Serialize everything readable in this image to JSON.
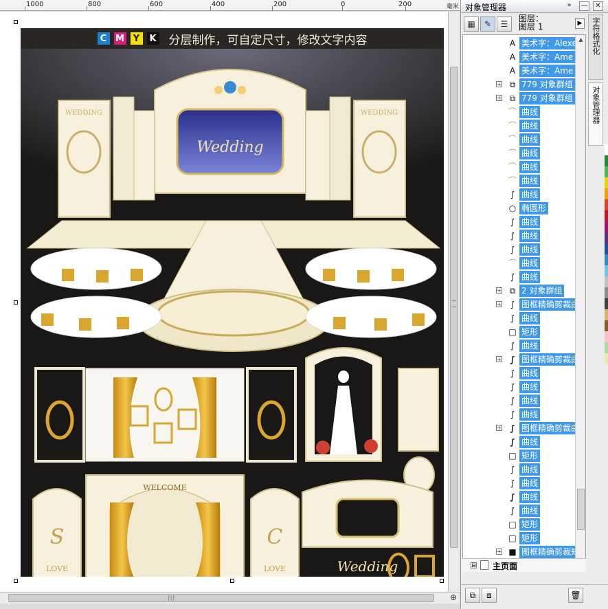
{
  "ruler": {
    "ticks": [
      "1000",
      "800",
      "600",
      "400",
      "200",
      "0",
      "200"
    ],
    "unit": "毫米"
  },
  "poster": {
    "banner": {
      "cmyk": [
        {
          "letter": "C",
          "color": "#1a7fd0"
        },
        {
          "letter": "M",
          "color": "#d21f7a"
        },
        {
          "letter": "Y",
          "color": "#f5e200"
        },
        {
          "letter": "K",
          "color": "#111111"
        }
      ],
      "text": "分层制作，可自定尺寸，修改文字内容"
    },
    "stage_texts": {
      "wedding_left": "WEDDING",
      "wedding_right": "WEDDING",
      "center_script": "Wedding",
      "welcome": "WELCOME",
      "love_left": "LOVE",
      "love_right": "LOVE",
      "monogram_left": "S",
      "monogram_right": "C",
      "bottom_script": "Wedding"
    }
  },
  "dock": {
    "title": "对象管理器",
    "title_buttons": {
      "collapse": "»",
      "minimize": "—",
      "close": "✕"
    },
    "layer_label": "图层：\n图层 1",
    "layer_arrow": "▶",
    "side_tabs": [
      "字符格式化",
      "对象管理器"
    ],
    "palette": [
      "#ffffff",
      "#1f8a3a",
      "#4db84d",
      "#e6d400",
      "#f0a000",
      "#e04020",
      "#c8102e",
      "#a01070",
      "#5a2d86",
      "#1f4fa0",
      "#2e8bc8",
      "#6ec3e8",
      "#bfbfbf",
      "#8c8c8c",
      "#404040",
      "#d9b26a",
      "#8a5a2b",
      "#f5c2c8",
      "#b0d9a0",
      "#e8e8b0"
    ],
    "objects": [
      {
        "icon": "text-icon",
        "label": "美术字：Alexe",
        "selected": true,
        "expandable": false
      },
      {
        "icon": "text-icon",
        "label": "美术字：Ame",
        "selected": true,
        "expandable": false
      },
      {
        "icon": "text-icon",
        "label": "美术字：Ame",
        "selected": true,
        "expandable": false
      },
      {
        "icon": "group-icon",
        "label": "779 对象群组",
        "selected": true,
        "expandable": true
      },
      {
        "icon": "group-icon",
        "label": "779 对象群组",
        "selected": true,
        "expandable": true
      },
      {
        "icon": "curve-light-icon",
        "label": "曲线",
        "selected": true,
        "expandable": false
      },
      {
        "icon": "curve-light-icon",
        "label": "曲线",
        "selected": true,
        "expandable": false
      },
      {
        "icon": "curve-light-icon",
        "label": "曲线",
        "selected": true,
        "expandable": false
      },
      {
        "icon": "curve-light-icon",
        "label": "曲线",
        "selected": true,
        "expandable": false
      },
      {
        "icon": "curve-light-icon",
        "label": "曲线",
        "selected": true,
        "expandable": false
      },
      {
        "icon": "curve-light-icon",
        "label": "曲线",
        "selected": true,
        "expandable": false
      },
      {
        "icon": "curve-icon",
        "label": "曲线",
        "selected": true,
        "expandable": false
      },
      {
        "icon": "ellipse-icon",
        "label": "椭圆形",
        "selected": true,
        "expandable": false
      },
      {
        "icon": "curve-icon",
        "label": "曲线",
        "selected": true,
        "expandable": false
      },
      {
        "icon": "curve-icon",
        "label": "曲线",
        "selected": true,
        "expandable": false
      },
      {
        "icon": "curve-icon",
        "label": "曲线",
        "selected": true,
        "expandable": false
      },
      {
        "icon": "curve-light-icon",
        "label": "曲线",
        "selected": true,
        "expandable": false
      },
      {
        "icon": "curve-icon",
        "label": "曲线",
        "selected": true,
        "expandable": false
      },
      {
        "icon": "group-icon",
        "label": "2 对象群组",
        "selected": true,
        "expandable": true
      },
      {
        "icon": "curve-icon",
        "label": "图框精确剪裁曲",
        "selected": true,
        "expandable": true
      },
      {
        "icon": "curve-icon",
        "label": "曲线",
        "selected": true,
        "expandable": false
      },
      {
        "icon": "rectangle-icon",
        "label": "矩形",
        "selected": true,
        "expandable": false
      },
      {
        "icon": "curve-icon",
        "label": "曲线",
        "selected": true,
        "expandable": false
      },
      {
        "icon": "curve-dark-icon",
        "label": "图框精确剪裁曲",
        "selected": true,
        "expandable": true
      },
      {
        "icon": "curve-icon",
        "label": "曲线",
        "selected": true,
        "expandable": false
      },
      {
        "icon": "curve-icon",
        "label": "曲线",
        "selected": true,
        "expandable": false
      },
      {
        "icon": "curve-icon",
        "label": "曲线",
        "selected": true,
        "expandable": false
      },
      {
        "icon": "curve-icon",
        "label": "曲线",
        "selected": true,
        "expandable": false
      },
      {
        "icon": "curve-dark-icon",
        "label": "图框精确剪裁曲",
        "selected": true,
        "expandable": true
      },
      {
        "icon": "curve-dark-icon",
        "label": "曲线",
        "selected": true,
        "expandable": false
      },
      {
        "icon": "rectangle-icon",
        "label": "矩形",
        "selected": true,
        "expandable": false
      },
      {
        "icon": "curve-icon",
        "label": "曲线",
        "selected": true,
        "expandable": false
      },
      {
        "icon": "curve-icon",
        "label": "曲线",
        "selected": true,
        "expandable": false
      },
      {
        "icon": "curve-dark-icon",
        "label": "曲线",
        "selected": true,
        "expandable": false
      },
      {
        "icon": "curve-icon",
        "label": "曲线",
        "selected": true,
        "expandable": false
      },
      {
        "icon": "rectangle-icon",
        "label": "矩形",
        "selected": true,
        "expandable": false
      },
      {
        "icon": "rectangle-icon",
        "label": "矩形",
        "selected": true,
        "expandable": false
      },
      {
        "icon": "filled-square-icon",
        "label": "图框精确剪裁矩",
        "selected": true,
        "expandable": true
      }
    ],
    "page_row": {
      "label": "主页面",
      "expander": "⊟"
    }
  }
}
